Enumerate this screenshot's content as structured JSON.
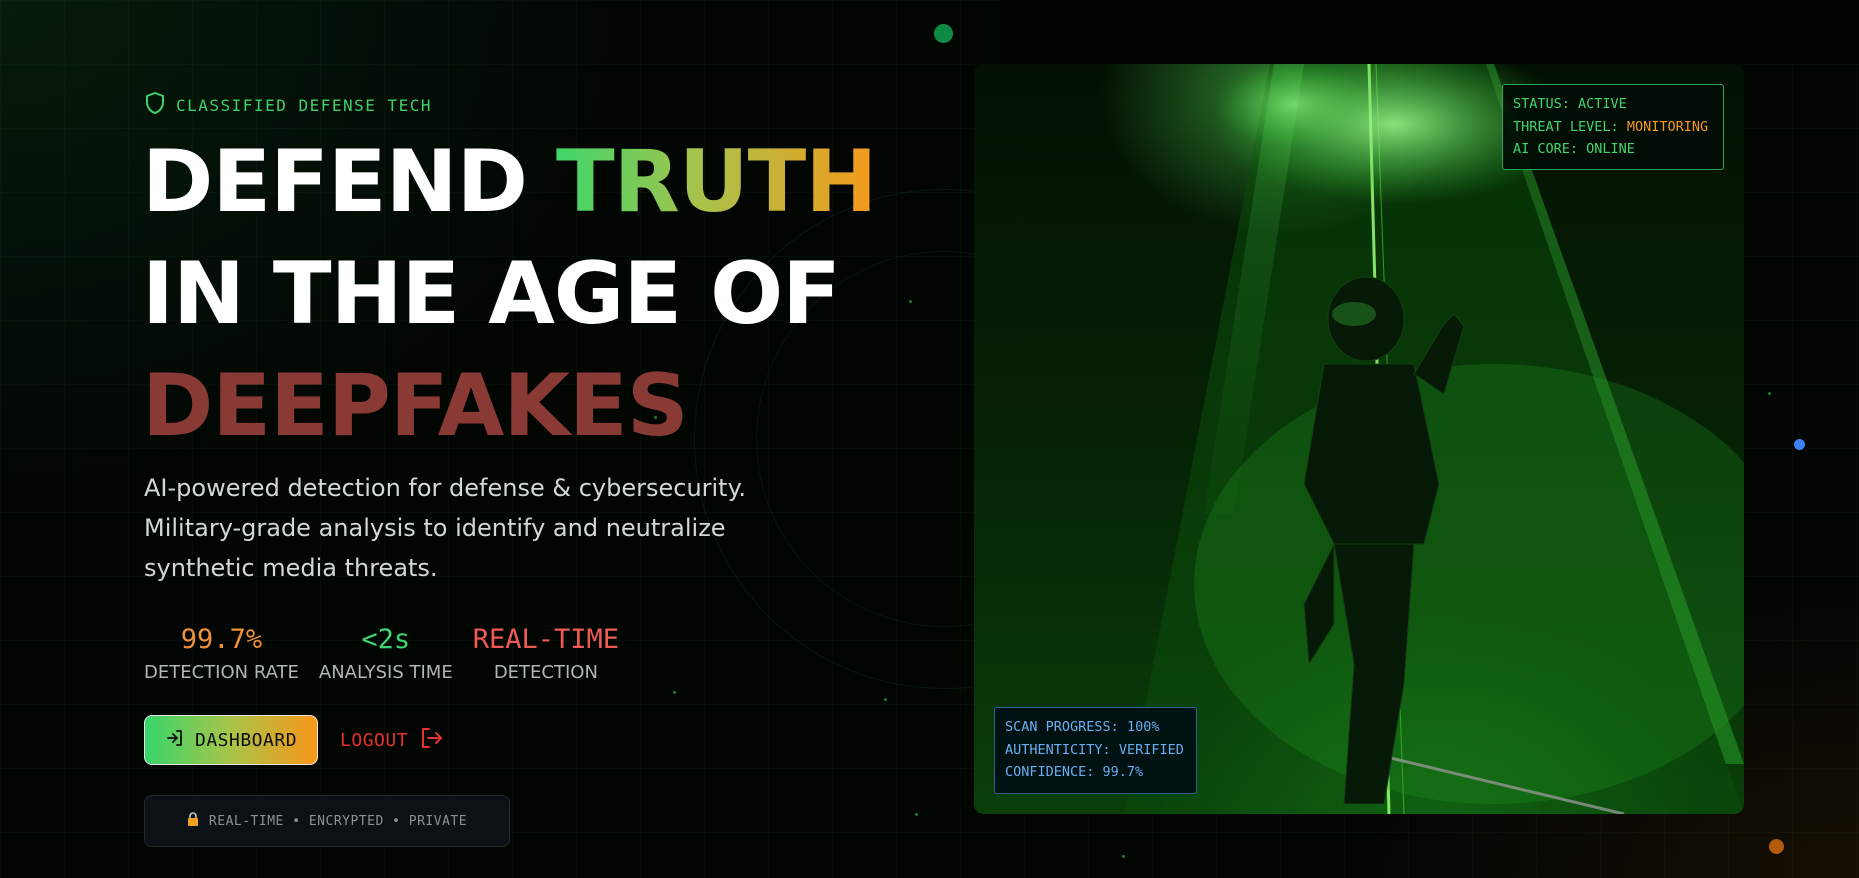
{
  "hero": {
    "badge": "CLASSIFIED DEFENSE TECH",
    "headline": {
      "line1_white": "DEFEND",
      "line1_gradient": "TRUTH",
      "line2": "IN THE AGE OF",
      "line3": "DEEPFAKES"
    },
    "subtitle": "AI-powered detection for defense & cybersecurity. Military-grade analysis to identify and neutralize synthetic media threats.",
    "stats": [
      {
        "value": "99.7%",
        "label": "DETECTION RATE",
        "color": "#f0913a"
      },
      {
        "value": "<2s",
        "label": "ANALYSIS TIME",
        "color": "#3ed673"
      },
      {
        "value": "REAL-TIME",
        "label": "DETECTION",
        "color": "#ef5a55"
      }
    ],
    "dashboard_button": "DASHBOARD",
    "logout_button": "LOGOUT",
    "secure_note": "REAL-TIME • ENCRYPTED • PRIVATE"
  },
  "status_panel": {
    "status_label": "STATUS:",
    "status_value": "ACTIVE",
    "threat_label": "THREAT LEVEL:",
    "threat_value": "MONITORING",
    "core_label": "AI CORE:",
    "core_value": "ONLINE"
  },
  "scan_panel": {
    "progress_label": "SCAN PROGRESS:",
    "progress_value": "100%",
    "authenticity_label": "AUTHENTICITY:",
    "authenticity_value": "VERIFIED",
    "confidence_label": "CONFIDENCE:",
    "confidence_value": "99.7%"
  },
  "icons": [
    "shield-icon",
    "login-icon",
    "logout-icon",
    "lock-icon"
  ],
  "colors": {
    "accent_green": "#3ed66a",
    "accent_orange": "#f59a1b",
    "danger_red": "#e5322d",
    "headline_red": "#8a3a35",
    "scan_blue": "#68aef2"
  }
}
